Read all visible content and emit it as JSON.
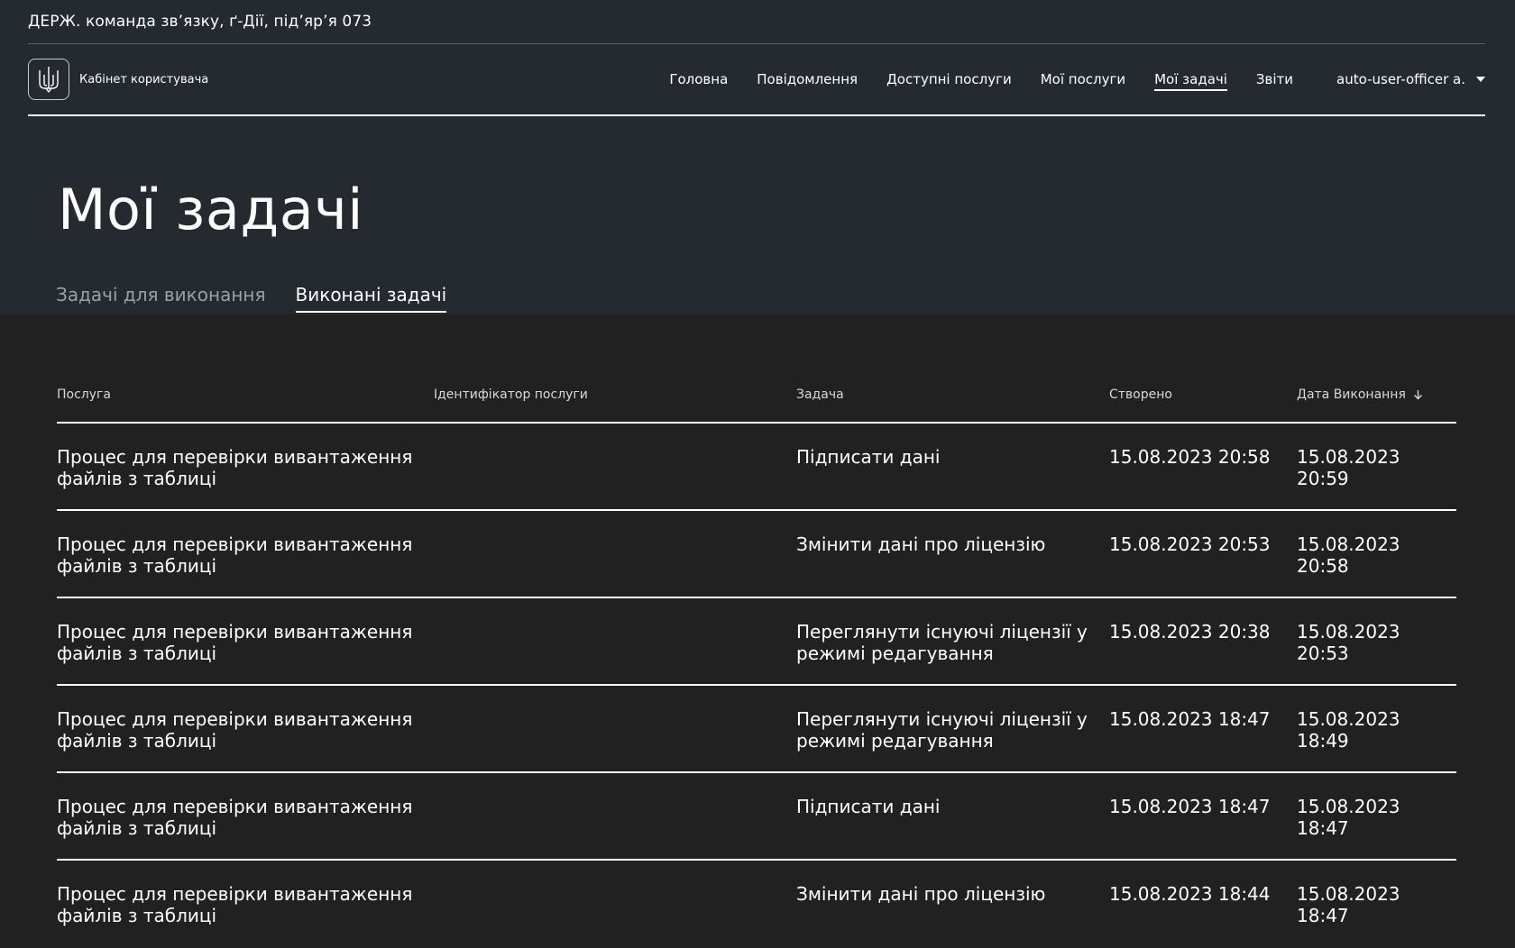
{
  "org": {
    "name": "ДЕРЖ. команда зв’язку, ґ-Дії, під’яр’я 073"
  },
  "header": {
    "cabinet_label": "Кабінет користувача",
    "nav": [
      {
        "label": "Головна"
      },
      {
        "label": "Повідомлення"
      },
      {
        "label": "Доступні послуги"
      },
      {
        "label": "Мої послуги"
      },
      {
        "label": "Мої задачі",
        "active": true
      },
      {
        "label": "Звіти"
      }
    ],
    "user": "auto-user-officer a."
  },
  "page": {
    "title": "Мої задачі",
    "tabs": [
      {
        "label": "Задачі для виконання",
        "active": false
      },
      {
        "label": "Виконані задачі",
        "active": true
      }
    ]
  },
  "table": {
    "columns": {
      "service": "Послуга",
      "service_id": "Ідентифікатор послуги",
      "task": "Задача",
      "created": "Створено",
      "completed": "Дата Виконання"
    },
    "rows": [
      {
        "service_line1": "Процес для перевірки вивантаження",
        "service_line2": "файлів з таблиці",
        "service_id": "",
        "task": "Підписати дані",
        "created": "15.08.2023 20:58",
        "completed": "15.08.2023 20:59"
      },
      {
        "service_line1": "Процес для перевірки вивантаження",
        "service_line2": "файлів з таблиці",
        "service_id": "",
        "task": "Змінити дані про ліцензію",
        "created": "15.08.2023 20:53",
        "completed": "15.08.2023 20:58"
      },
      {
        "service_line1": "Процес для перевірки вивантаження",
        "service_line2": "файлів з таблиці",
        "service_id": "",
        "task": "Переглянути існуючі ліцензії у режимі редагування",
        "created": "15.08.2023 20:38",
        "completed": "15.08.2023 20:53"
      },
      {
        "service_line1": "Процес для перевірки вивантаження",
        "service_line2": "файлів з таблиці",
        "service_id": "",
        "task": "Переглянути існуючі ліцензії у режимі редагування",
        "created": "15.08.2023 18:47",
        "completed": "15.08.2023 18:49"
      },
      {
        "service_line1": "Процес для перевірки вивантаження",
        "service_line2": "файлів з таблиці",
        "service_id": "",
        "task": "Підписати дані",
        "created": "15.08.2023 18:47",
        "completed": "15.08.2023 18:47"
      },
      {
        "service_line1": "Процес для перевірки вивантаження",
        "service_line2": "файлів з таблиці",
        "service_id": "",
        "task": "Змінити дані про ліцензію",
        "created": "15.08.2023 18:44",
        "completed": "15.08.2023 18:47"
      }
    ]
  }
}
